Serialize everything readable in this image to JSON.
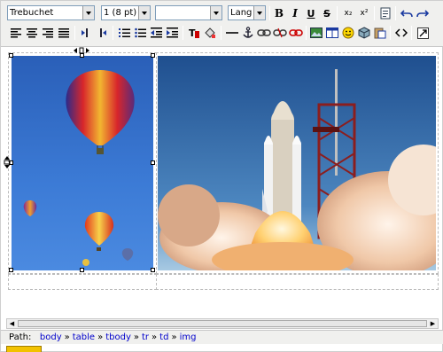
{
  "toolbar": {
    "font_family": "Trebuchet",
    "font_size": "1 (8 pt)",
    "format": "",
    "language": "Lang",
    "labels": {
      "bold": "B",
      "italic": "I",
      "underline": "U",
      "strike": "S",
      "subscript": "x₂",
      "superscript": "x²"
    }
  },
  "path": {
    "label": "Path:",
    "items": [
      "body",
      "table",
      "tbody",
      "tr",
      "td",
      "img"
    ],
    "separator": "»"
  },
  "colors": {
    "toolbar_bg": "#f0f0ee",
    "link": "#0000cc"
  }
}
